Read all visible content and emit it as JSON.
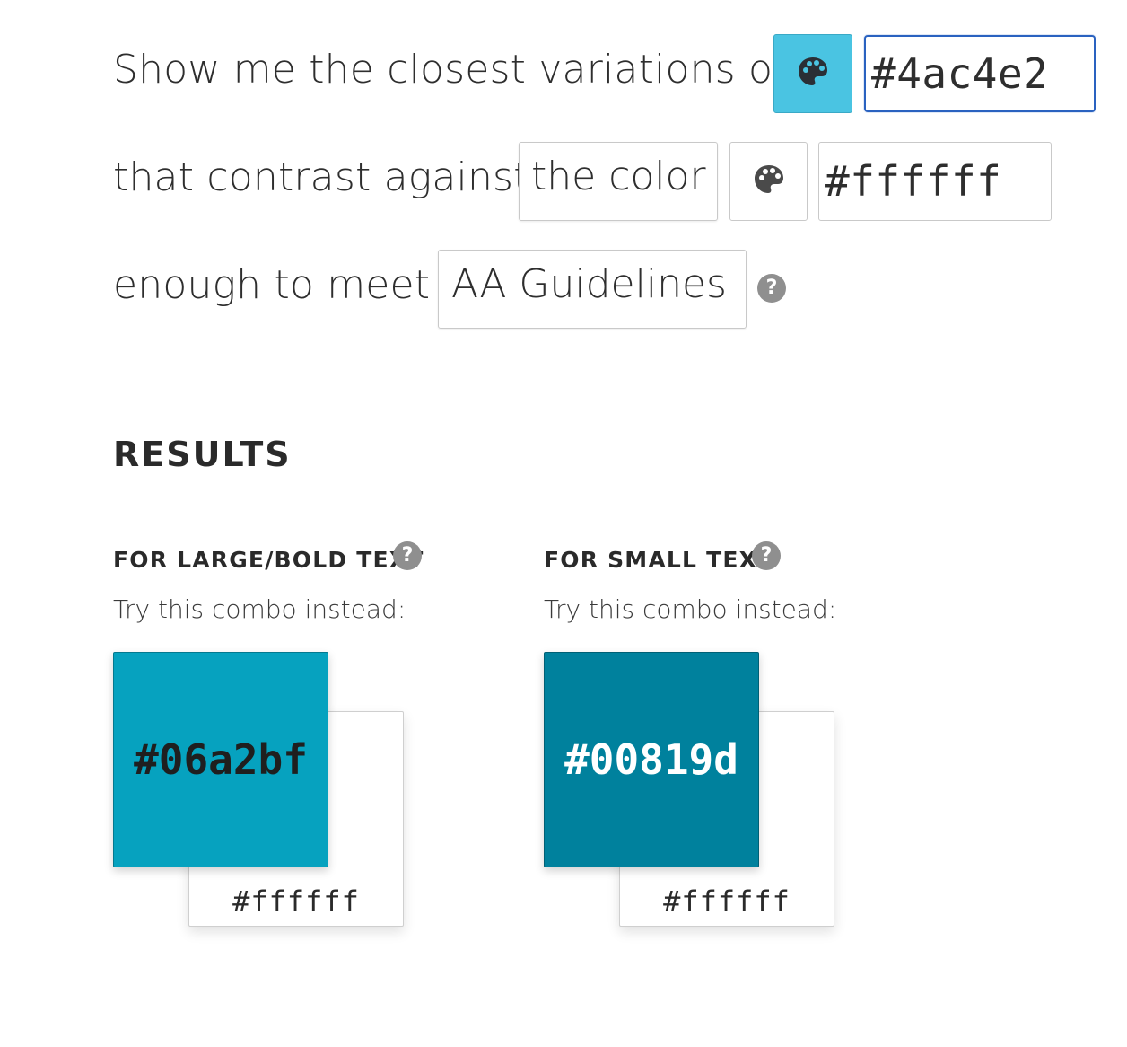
{
  "query": {
    "line1_text": "Show me the closest variations of",
    "line2_text": "that contrast against",
    "line3_text": "enough to meet",
    "source_color": {
      "swatch_color": "#4ac4e2",
      "value": "#4ac4e2",
      "icon": "palette-icon"
    },
    "contrast_mode": {
      "selected": "the color"
    },
    "target_color": {
      "icon": "palette-icon",
      "value": "#ffffff"
    },
    "guideline": {
      "selected": "AA Guidelines",
      "help_icon": "question-icon"
    }
  },
  "results": {
    "heading": "RESULTS",
    "large_text": {
      "heading": "FOR LARGE/BOLD TEXT",
      "subtitle": "Try this combo instead:",
      "foreground": "#06a2bf",
      "foreground_text_color": "#1f1f1f",
      "background": "#ffffff"
    },
    "small_text": {
      "heading": "FOR SMALL TEXT",
      "subtitle": "Try this combo instead:",
      "foreground": "#00819d",
      "foreground_text_color": "#ffffff",
      "background": "#ffffff"
    }
  }
}
